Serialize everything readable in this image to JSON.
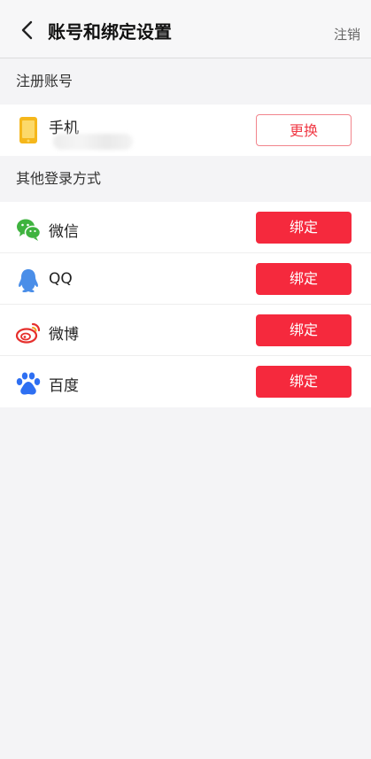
{
  "header": {
    "title": "账号和绑定设置",
    "logout_label": "注销"
  },
  "registered": {
    "section_title": "注册账号",
    "phone_label": "手机",
    "change_button": "更换"
  },
  "other_login": {
    "section_title": "其他登录方式",
    "items": [
      {
        "label": "微信",
        "button": "绑定",
        "icon": "wechat-icon"
      },
      {
        "label": "QQ",
        "button": "绑定",
        "icon": "qq-icon"
      },
      {
        "label": "微博",
        "button": "绑定",
        "icon": "weibo-icon"
      },
      {
        "label": "百度",
        "button": "绑定",
        "icon": "baidu-icon"
      }
    ]
  },
  "colors": {
    "accent": "#f5293d",
    "background": "#f4f4f6",
    "wechat": "#3fb33f",
    "qq": "#4a8ee8",
    "weibo": "#e6302d",
    "baidu": "#2e6ff2",
    "phone": "#f5b71b"
  }
}
